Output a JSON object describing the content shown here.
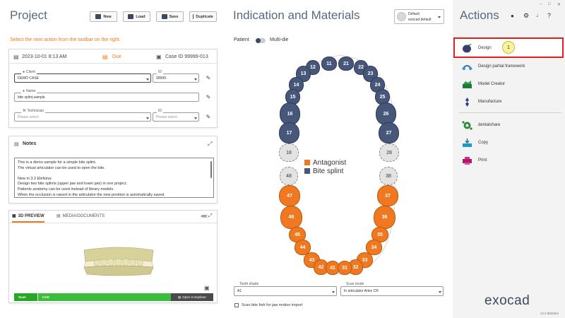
{
  "project": {
    "title": "Project",
    "buttons": {
      "new": "New",
      "load": "Load",
      "save": "Save",
      "duplicate": "Duplicate"
    },
    "hint": "Select the next action from the toolbar on the right.",
    "info": {
      "date": "2023-10-01 8:13 AM",
      "due": "Due",
      "case_id": "Case ID 99999-013"
    },
    "client": {
      "label": "Client",
      "value": "DEMO CASE"
    },
    "client_id": {
      "label": "ID",
      "value": "99999"
    },
    "name": {
      "label": "Name",
      "value": "bite splint,sample"
    },
    "technician": {
      "label": "Technician",
      "placeholder": "Please select"
    },
    "technician_id": {
      "label": "ID",
      "placeholder": "Please select"
    }
  },
  "notes": {
    "title": "Notes",
    "lines": [
      "This is a demo sample for a simple bite splint.",
      "The virtual articulator can be used to open the bite.",
      "",
      "New in 3.2 Elefsina:",
      "Design two bite splints (upper jaw and lower jaw) in one project.",
      "Patients anatomy can be used instead of library models.",
      "When the occlusion is raised in the articulator the new position is automatically saved."
    ]
  },
  "preview": {
    "tab_3d": "3D PREVIEW",
    "tab_media": "MEDIA/DOCUMENTS",
    "progress": {
      "scan": "Scan",
      "cad": "CAD",
      "explorer": "Open in Explorer"
    }
  },
  "indication": {
    "title": "Indication and Materials",
    "preset": {
      "line1": "Default",
      "line2": "exocad default"
    },
    "toggle": {
      "left": "Patient",
      "right": "Multi-die"
    },
    "legend": [
      {
        "label": "Antagonist",
        "color": "#f07820"
      },
      {
        "label": "Bite splint",
        "color": "#47577a"
      }
    ],
    "tooth_shade": {
      "label": "Tooth shade",
      "value": "A1"
    },
    "scan_mode": {
      "label": "Scan mode",
      "value": "In articulator Artex CR"
    },
    "checkbox": "Scan bite fork for jaw motion import"
  },
  "teeth": [
    {
      "n": "11",
      "m": "b"
    },
    {
      "n": "21",
      "m": "b"
    },
    {
      "n": "12",
      "m": "b"
    },
    {
      "n": "22",
      "m": "b"
    },
    {
      "n": "13",
      "m": "b"
    },
    {
      "n": "23",
      "m": "b"
    },
    {
      "n": "14",
      "m": "b"
    },
    {
      "n": "24",
      "m": "b"
    },
    {
      "n": "15",
      "m": "b"
    },
    {
      "n": "25",
      "m": "b"
    },
    {
      "n": "16",
      "m": "b"
    },
    {
      "n": "26",
      "m": "b"
    },
    {
      "n": "17",
      "m": "b"
    },
    {
      "n": "27",
      "m": "b"
    },
    {
      "n": "18",
      "m": "g"
    },
    {
      "n": "28",
      "m": "g"
    },
    {
      "n": "48",
      "m": "g"
    },
    {
      "n": "38",
      "m": "g"
    },
    {
      "n": "47",
      "m": "o"
    },
    {
      "n": "37",
      "m": "o"
    },
    {
      "n": "46",
      "m": "o"
    },
    {
      "n": "36",
      "m": "o"
    },
    {
      "n": "45",
      "m": "o"
    },
    {
      "n": "35",
      "m": "o"
    },
    {
      "n": "44",
      "m": "o"
    },
    {
      "n": "34",
      "m": "o"
    },
    {
      "n": "43",
      "m": "o"
    },
    {
      "n": "33",
      "m": "o"
    },
    {
      "n": "42",
      "m": "o"
    },
    {
      "n": "32",
      "m": "o"
    },
    {
      "n": "41",
      "m": "o"
    },
    {
      "n": "31",
      "m": "o"
    }
  ],
  "actions": {
    "title": "Actions",
    "items": [
      {
        "label": "Design",
        "badge": "1"
      },
      {
        "label": "Design partial framework"
      },
      {
        "label": "Model Creator"
      },
      {
        "label": "Manufacture"
      },
      {
        "label": "dentalshare"
      },
      {
        "label": "Copy"
      },
      {
        "label": "Print"
      }
    ],
    "brand": "exocad",
    "version": "v3.2.9825/64"
  },
  "colors": {
    "accent_orange": "#f07820",
    "splint_blue": "#47577a",
    "highlight_red": "#e0201e",
    "progress_green": "#26a826"
  }
}
